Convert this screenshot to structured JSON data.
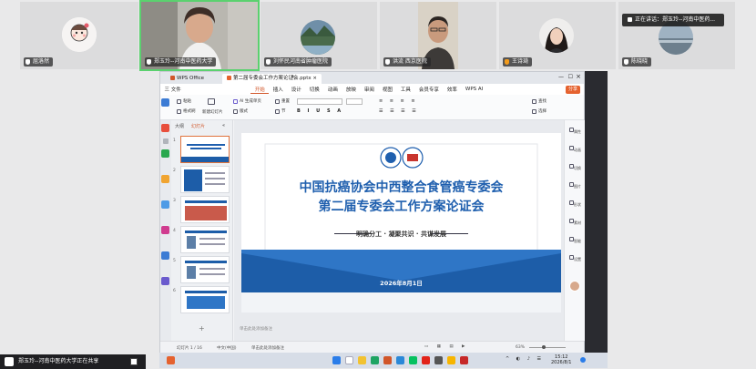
{
  "participants": [
    {
      "name": "屈洛然"
    },
    {
      "name": "郑玉玲--河南中医药大学"
    },
    {
      "name": "刘怀民河南省肿瘤医院"
    },
    {
      "name": "洪流 西京医院"
    },
    {
      "name": "王诗琦"
    },
    {
      "name": "陈晓晓"
    }
  ],
  "speaking_text": "正在讲话：郑玉玲--河南中医药...",
  "sharing_text": "郑玉玲--河南中医药大学正在共享",
  "wps": {
    "tabs": [
      "WPS Office",
      "第二届专委会工作方案论证会.pptx"
    ],
    "menu": [
      "三 文件",
      "开始",
      "插入",
      "设计",
      "切换",
      "动画",
      "放映",
      "审阅",
      "视图",
      "工具",
      "会员专享",
      "效率",
      "WPS AI"
    ],
    "share_label": "分享",
    "ribbon": {
      "paste": "粘贴",
      "format_painter": "格式刷",
      "new_slide": "新建幻灯片",
      "ai_generate": "AI 生成单页",
      "layout": "版式",
      "reset": "重置",
      "section": "节",
      "find": "查找",
      "select": "选择"
    },
    "panel_tabs": [
      "大纲",
      "幻灯片"
    ],
    "slide_numbers": [
      "1",
      "2",
      "3",
      "4",
      "5",
      "6"
    ],
    "right_rail": [
      "属性",
      "动画",
      "切换",
      "图片",
      "形状",
      "素材",
      "智能",
      "设置"
    ],
    "status_left": "幻灯片 1 / 16",
    "status_lang": "中文(中国)",
    "status_notes": "单击此处添加备注",
    "zoom": "63%"
  },
  "slide": {
    "title_line1": "中国抗癌协会中西整合食管癌专委会",
    "title_line2": "第二届专委会工作方案论证会",
    "subtitle": "明确分工 · 凝聚共识 · 共谋发展",
    "date": "2026年8月1日",
    "colors": {
      "title": "#1f5fae",
      "band": "#1d5da8",
      "band_light": "#2f76c6"
    }
  },
  "taskbar": {
    "time": "15:12",
    "date": "2026/8/1"
  }
}
